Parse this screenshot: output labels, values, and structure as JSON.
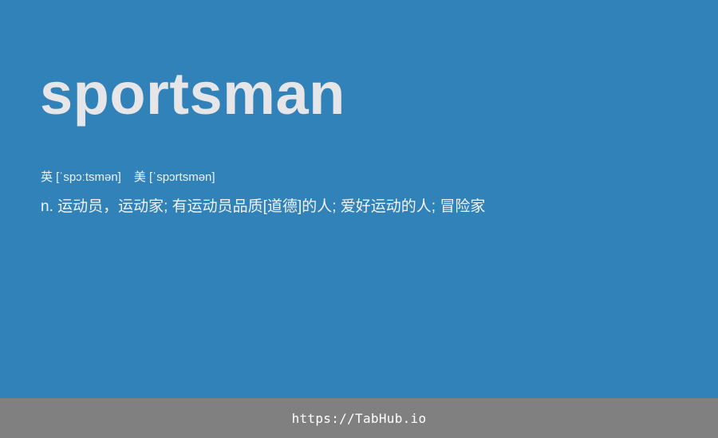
{
  "entry": {
    "word": "sportsman",
    "phonetics": {
      "uk": "英 [ˈspɔːtsmən]",
      "us": "美 [ˈspɔrtsmən]"
    },
    "definition": "n. 运动员，运动家; 有运动员品质[道德]的人; 爱好运动的人; 冒险家"
  },
  "footer": {
    "link_text": "https://TabHub.io"
  },
  "colors": {
    "background": "#3182b8",
    "word_text": "#e6e6e9",
    "footer_bg": "#808080",
    "footer_text": "#ffffff"
  }
}
